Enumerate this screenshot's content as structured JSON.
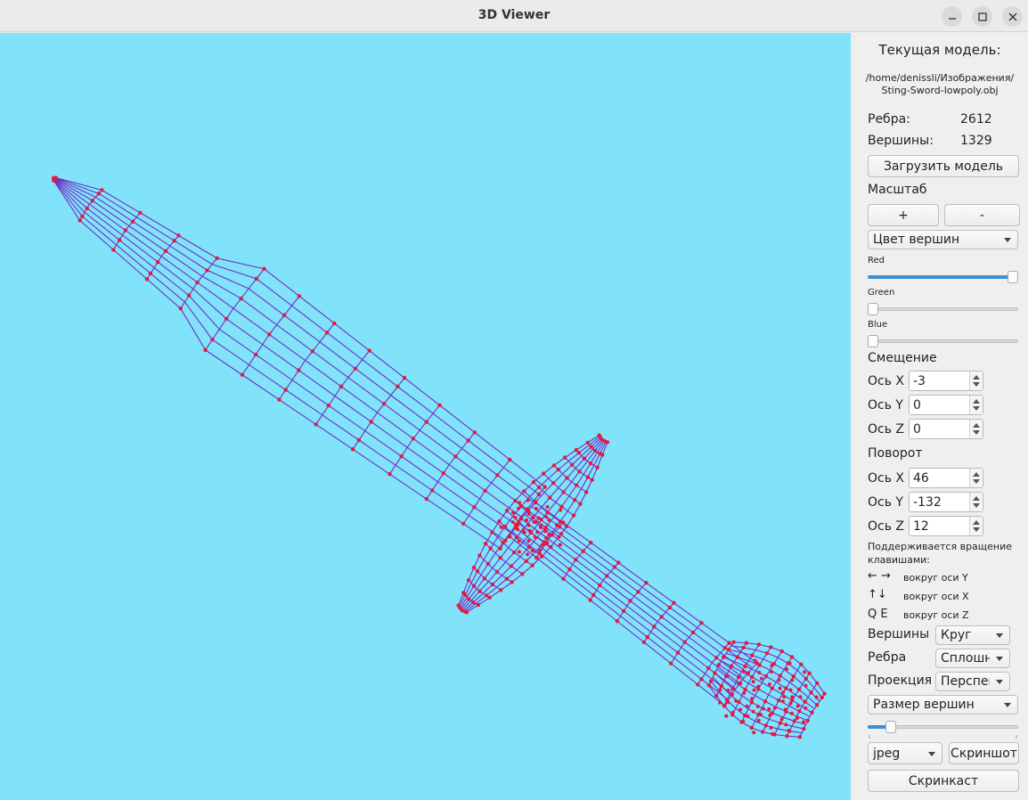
{
  "window": {
    "title": "3D Viewer"
  },
  "colors": {
    "viewport_bg": "#80e3fa",
    "edge_color": "#6f2fc7",
    "vertex_color": "#e8183a"
  },
  "panel": {
    "current_model_label": "Текущая модель:",
    "model_path_line1": "/home/denissli/Изображения/",
    "model_path_line2": "Sting-Sword-lowpoly.obj",
    "edges_label": "Ребра:",
    "edges_value": "2612",
    "vertices_label": "Вершины:",
    "vertices_value": "1329",
    "load_button": "Загрузить модель",
    "scale_label": "Масштаб",
    "scale_plus": "+",
    "scale_minus": "-",
    "color_combo": "Цвет вершин",
    "red_label": "Red",
    "green_label": "Green",
    "blue_label": "Blue",
    "red_level": 1.0,
    "green_level": 0.0,
    "blue_level": 0.0,
    "translation_label": "Смещение",
    "tx_label": "Ось X",
    "tx_value": "-3",
    "ty_label": "Ось Y",
    "ty_value": "0",
    "tz_label": "Ось Z",
    "tz_value": "0",
    "rotation_label": "Поворот",
    "rx_label": "Ось X",
    "rx_value": "46",
    "ry_label": "Ось Y",
    "ry_value": "-132",
    "rz_label": "Ось Z",
    "rz_value": "12",
    "keys_hint_line1": "Поддерживается вращение",
    "keys_hint_line2": "клавишами:",
    "key_lr": "← →",
    "key_lr_desc": "вокруг оси Y",
    "key_ud": "↑↓",
    "key_ud_desc": "вокруг оси X",
    "key_qe": "Q E",
    "key_qe_desc": "вокруг оси Z",
    "vertices_type_label": "Вершины",
    "vertices_type_value": "Круг",
    "edges_type_label": "Ребра",
    "edges_type_value": "Сплошные",
    "projection_label": "Проекция",
    "projection_value": "Перспектива",
    "vertex_size_combo": "Размер вершин",
    "vertex_size_level": 0.13,
    "format_value": "jpeg",
    "screenshot_button": "Скриншот",
    "screencast_button": "Скринкаст"
  }
}
